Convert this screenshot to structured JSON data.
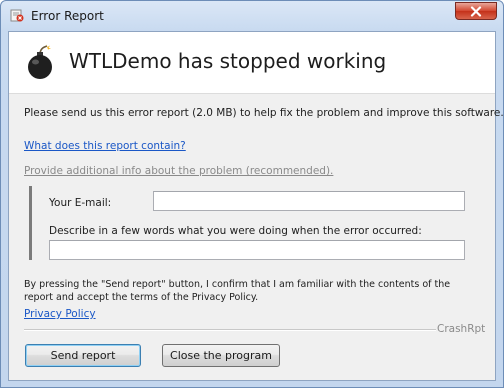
{
  "window": {
    "title": "Error Report",
    "close_icon": "close-icon",
    "app_icon": "error-report-icon"
  },
  "header": {
    "icon": "bomb-icon",
    "title": "WTLDemo has stopped working"
  },
  "body": {
    "intro": "Please send us this error report (2.0 MB) to help fix the problem and improve this software.",
    "what_link": "What does this report contain?",
    "additional_link": "Provide additional info about the problem (recommended).",
    "email_label": "Your E-mail:",
    "email_value": "",
    "describe_label": "Describe in a few words what you were doing when the error occurred:",
    "describe_value": "",
    "consent_text": "By pressing the \"Send report\" button, I confirm that I am familiar with the contents of the report and accept the terms of the Privacy Policy.",
    "privacy_link": "Privacy Policy",
    "brand": "CrashRpt"
  },
  "buttons": {
    "send": "Send report",
    "close": "Close the program"
  }
}
